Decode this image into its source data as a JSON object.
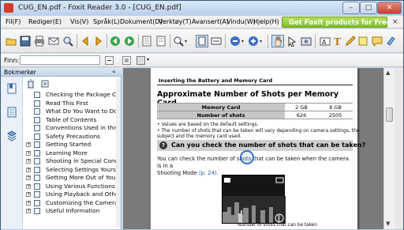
{
  "window": {
    "title": "CUG_EN.pdf - Foxit Reader 3.0 - [CUG_EN.pdf]",
    "minimize": "–",
    "maximize": "□",
    "close": "✕"
  },
  "menu": {
    "items": [
      "Fil(F)",
      "Rediger(E)",
      "Vis(V)",
      "Språk(L)",
      "Dokument(D)",
      "Verktøy(T)",
      "Avansert(A)",
      "Vindu(W)",
      "Hjelp(H)"
    ],
    "promo": "Get Foxit products for Free",
    "promo_close": "×"
  },
  "toolbar": {
    "icons": [
      "open-folder-icon",
      "save-icon",
      "print-icon",
      "email-icon",
      "search-icon",
      "first-page-icon",
      "previous-page-icon",
      "back-icon",
      "forward-icon",
      "next-page-icon",
      "last-page-icon",
      "copy-icon",
      "zoom-icon",
      "fit-page-icon",
      "fit-width-icon",
      "zoom-out-icon",
      "zoom-in-icon",
      "hand-icon",
      "select-text-icon",
      "snapshot-icon",
      "typewriter-icon",
      "highlight-icon"
    ]
  },
  "findbar": {
    "label": "Finn:",
    "value": ""
  },
  "sidebar": {
    "title": "Bokmerker",
    "collapse": "«",
    "bookmarks": [
      {
        "label": "Checking the Package Conte",
        "expandable": false
      },
      {
        "label": "Read This First",
        "expandable": false
      },
      {
        "label": "What Do You Want to Do?",
        "expandable": false
      },
      {
        "label": "Table of Contents",
        "expandable": false
      },
      {
        "label": "Conventions Used in this Guid",
        "expandable": false
      },
      {
        "label": "Safety Precautions",
        "expandable": false
      },
      {
        "label": "Getting Started",
        "expandable": true
      },
      {
        "label": "Learning More",
        "expandable": true
      },
      {
        "label": "Shooting in Special Condition",
        "expandable": true
      },
      {
        "label": "Selecting Settings Yourself",
        "expandable": true
      },
      {
        "label": "Getting More Out of Your Ca",
        "expandable": true
      },
      {
        "label": "Using Various Functions for S",
        "expandable": true
      },
      {
        "label": "Using Playback and Other Fu",
        "expandable": true
      },
      {
        "label": "Customizing the Camera",
        "expandable": true
      },
      {
        "label": "Useful Information",
        "expandable": true
      }
    ]
  },
  "page": {
    "header": "Inserting the Battery and Memory Card",
    "heading": "Approximate Number of Shots per Memory Card",
    "table": {
      "row1": [
        "Memory Card",
        "2 GB",
        "8 GB"
      ],
      "row2": [
        "Number of shots",
        "626",
        "2505"
      ]
    },
    "notes": [
      "• Values are based on the default settings.",
      "• The number of shots that can be taken will vary depending on camera settings, the",
      "  subject and the memory card used."
    ],
    "question": "Can you check the number of shots that can be taken?",
    "question_icon": "?",
    "para_before": "You can check the number of shots that can be taken when the camera is in a",
    "para_after": "Shooting Mode",
    "para_link": "(p. 24).",
    "caption": "Number of shots that can be taken"
  }
}
